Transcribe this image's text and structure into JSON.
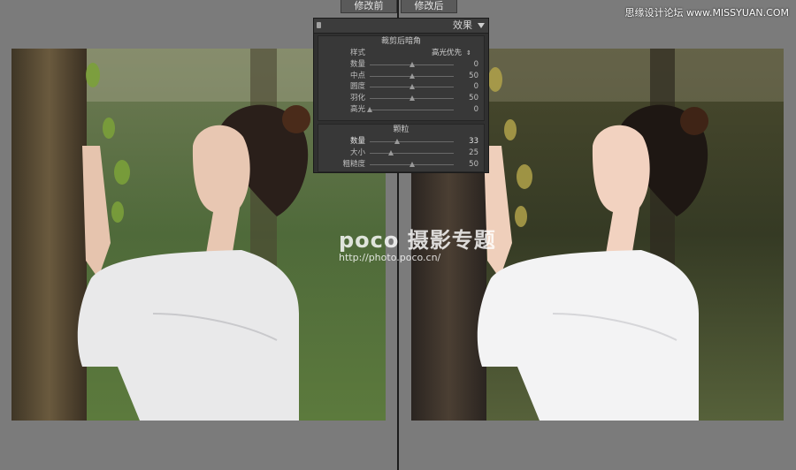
{
  "labels": {
    "before": "修改前",
    "after": "修改后"
  },
  "watermark": {
    "site": "思缘设计论坛 www.MISSYUAN.COM",
    "brand": "poco 摄影专题",
    "url": "http://photo.poco.cn/"
  },
  "panel": {
    "title": "效果",
    "vignette": {
      "title": "裁剪后暗角",
      "style_label": "样式",
      "style_value": "高光优先",
      "sliders": [
        {
          "label": "数量",
          "value": "0",
          "pos": 0.5
        },
        {
          "label": "中点",
          "value": "50",
          "pos": 0.5
        },
        {
          "label": "圆度",
          "value": "0",
          "pos": 0.5
        },
        {
          "label": "羽化",
          "value": "50",
          "pos": 0.5
        },
        {
          "label": "高光",
          "value": "0",
          "pos": 0.0
        }
      ]
    },
    "grain": {
      "title": "颗粒",
      "sliders": [
        {
          "label": "数量",
          "value": "33",
          "pos": 0.33
        },
        {
          "label": "大小",
          "value": "25",
          "pos": 0.25
        },
        {
          "label": "粗糙度",
          "value": "50",
          "pos": 0.5
        }
      ]
    }
  },
  "colors": {
    "background": "#7b7b7b",
    "panel": "#303030",
    "divider": "#1c1c1c"
  }
}
